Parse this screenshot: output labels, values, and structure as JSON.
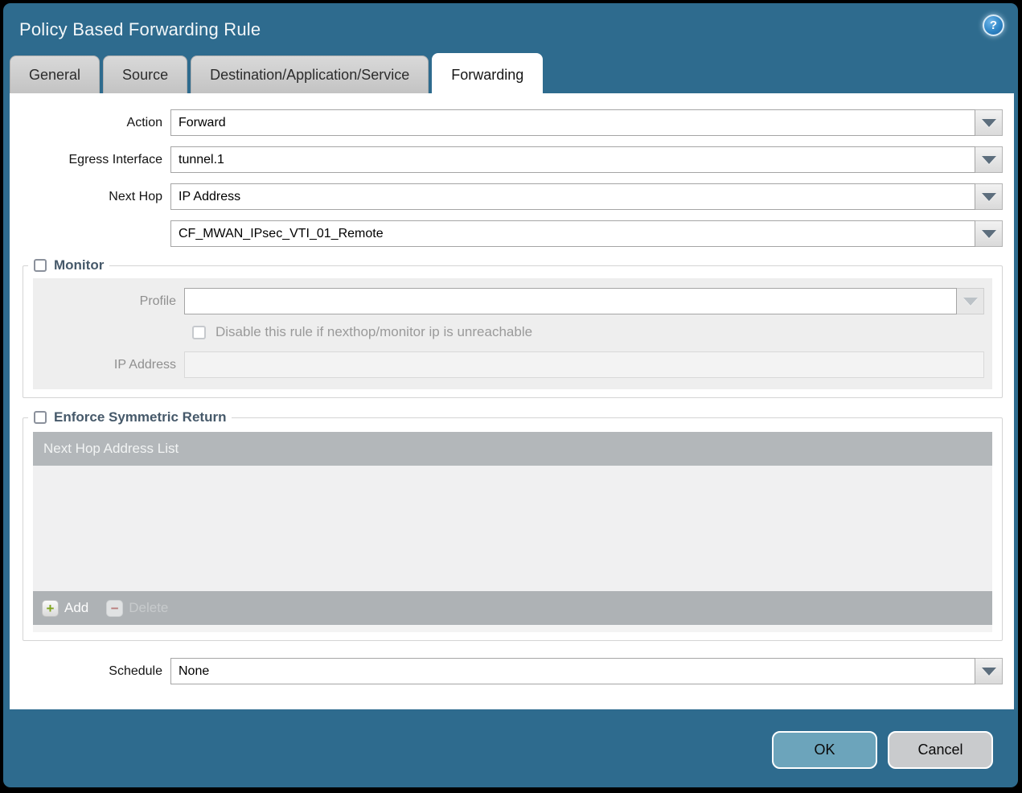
{
  "dialog": {
    "title": "Policy Based Forwarding Rule"
  },
  "icons": {
    "help": "?",
    "add": "+",
    "delete": "−"
  },
  "tabs": [
    {
      "label": "General",
      "active": false
    },
    {
      "label": "Source",
      "active": false
    },
    {
      "label": "Destination/Application/Service",
      "active": false
    },
    {
      "label": "Forwarding",
      "active": true
    }
  ],
  "form": {
    "action": {
      "label": "Action",
      "value": "Forward"
    },
    "egress_interface": {
      "label": "Egress Interface",
      "value": "tunnel.1"
    },
    "next_hop": {
      "label": "Next Hop",
      "value": "IP Address"
    },
    "next_hop_address": {
      "value": "CF_MWAN_IPsec_VTI_01_Remote"
    },
    "schedule": {
      "label": "Schedule",
      "value": "None"
    }
  },
  "monitor": {
    "legend": "Monitor",
    "checked": false,
    "profile": {
      "label": "Profile",
      "value": ""
    },
    "disable_rule": {
      "label": "Disable this rule if nexthop/monitor ip is unreachable",
      "checked": false
    },
    "ip_address": {
      "label": "IP Address",
      "value": ""
    }
  },
  "symmetric_return": {
    "legend": "Enforce Symmetric Return",
    "checked": false,
    "table": {
      "header": "Next Hop Address List",
      "rows": []
    },
    "add_label": "Add",
    "delete_label": "Delete"
  },
  "footer": {
    "ok_label": "OK",
    "cancel_label": "Cancel"
  },
  "colors": {
    "chrome_teal": "#2e6b8e",
    "active_tab": "#ffffff",
    "inactive_tab": "#c9c9c9",
    "disabled_field_cream": "#f5eedc",
    "table_header_gray": "#b3b7ba",
    "ok_button": "#6ca4bb",
    "cancel_button": "#c9cbcd",
    "add_plus_green": "#7fa41d",
    "delete_minus_red": "#b97e7e"
  }
}
